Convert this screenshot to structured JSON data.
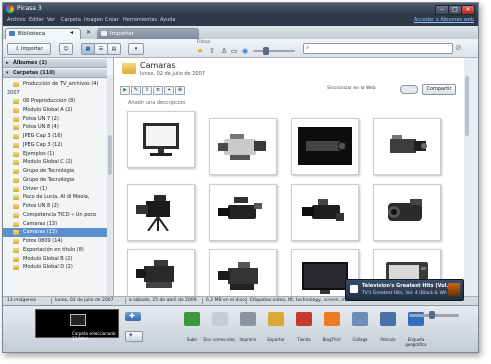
{
  "app": {
    "title": "Picasa 3",
    "menu": [
      "Archivo",
      "Editar",
      "Ver",
      "Carpeta",
      "Imagen",
      "Crear",
      "Herramientas",
      "Ayuda"
    ],
    "account_link": "Acceder a Álbumes web",
    "tabs": [
      {
        "label": "Biblioteca",
        "active": true
      },
      {
        "label": "Importar",
        "active": false
      }
    ]
  },
  "toolbar": {
    "import_label": "Importar",
    "filters_label": "Filtros",
    "search_placeholder": ""
  },
  "sidebar": {
    "albums_label": "Álbumes (1)",
    "folders_label": "Carpetas (110)",
    "year_label": "2007",
    "items_before_year": [
      "Producción de TV_archivos (4)"
    ],
    "items": [
      "08 Preproduccion (8)",
      "Modulo Global A (2)",
      "Fotos UN 7 (2)",
      "Fotos UN 8 (4)",
      "JPEG Cap 3 (16)",
      "JPEG Cap 3 (12)",
      "Ejemplos (1)",
      "Modulo Global C (2)",
      "Grupo de Tecnologia",
      "Grupo de Tecnologia",
      "Driver (1)",
      "Paco de Lucia, Al di Meola,",
      "Fotos UN 8 (2)",
      "Competencia TICD « Un poco",
      "Camaras (13)",
      "Camaras (13)",
      "Fotos 0809 (14)",
      "Exportación en titulo (8)",
      "Modulo Global B (2)",
      "Modulo Global D (2)"
    ],
    "selected_index": 15
  },
  "folder": {
    "title": "Camaras",
    "date": "lunes, 02 de julio de 2007",
    "description_placeholder": "Añadir una descripción",
    "sync_label": "Sincronizar en la Web",
    "share_label": "Compartir",
    "thumbnails": [
      "monitor",
      "camcorder-silver",
      "camera-dark",
      "security-camera",
      "broadcast-camera",
      "camcorder-black",
      "camcorder-black",
      "handycam",
      "pro-camera",
      "pro-camera",
      "flat-monitor",
      "tv-set"
    ]
  },
  "status_bar": [
    "13 imágenes",
    "lunes, 02 de julio de 2007",
    "a sábado, 25 de abril de 2009",
    "6,2 MB en el disco",
    "Etiquetas:video, tft, technology, screen, monitor, modern"
  ],
  "notification": {
    "title": "Television's Greatest Hits (Vol. 4",
    "subtitle": "TV's Greatest Hits, Vol. 4 (Black & Wh"
  },
  "tray": {
    "hold_label": "Carpeta seleccionada: 13 fotos"
  },
  "actions": [
    {
      "label": "Subir",
      "icon": "upload-icon",
      "color": "#3a9a3a"
    },
    {
      "label": "Env. correo elec.",
      "icon": "email-icon",
      "color": "#c9ced6"
    },
    {
      "label": "Imprimir",
      "icon": "print-icon",
      "color": "#8a939f"
    },
    {
      "label": "Exportar",
      "icon": "export-folder-icon",
      "color": "#d9a933"
    },
    {
      "label": "Tienda",
      "icon": "shop-icon",
      "color": "#c23b2b"
    },
    {
      "label": "BlogThis!",
      "icon": "blogger-icon",
      "color": "#f07b1e"
    },
    {
      "label": "Collage",
      "icon": "collage-icon",
      "color": "#6d8fb7"
    },
    {
      "label": "Película",
      "icon": "movie-icon",
      "color": "#4a6fa8"
    },
    {
      "label": "Etiqueta geográfica",
      "icon": "globe-icon",
      "color": "#2f6fc0"
    }
  ]
}
